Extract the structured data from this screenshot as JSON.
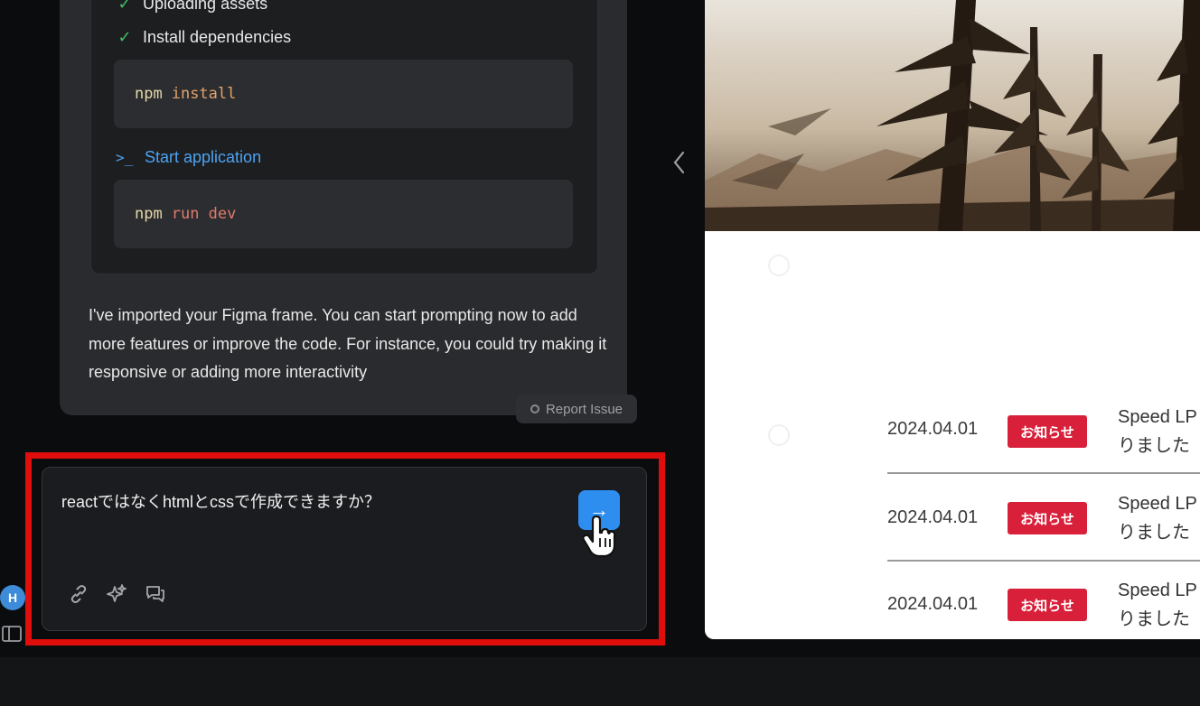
{
  "chat": {
    "steps": [
      {
        "status": "done",
        "label": "Uploading assets"
      },
      {
        "status": "done",
        "label": "Install dependencies"
      }
    ],
    "install_cmd": {
      "cmd": "npm",
      "arg": "install"
    },
    "start_label": "Start application",
    "run_cmd": {
      "cmd": "npm",
      "arg": "run dev"
    },
    "message": "I've imported your Figma frame. You can start prompting now to add more features or improve the code. For instance, you could try making it responsive or adding more interactivity",
    "report_label": "Report Issue"
  },
  "composer": {
    "text": "reactではなくhtmlとcssで作成できますか？",
    "send_icon": "arrow-right-icon",
    "tools": [
      "link-icon",
      "sparkle-icon",
      "chat-icon"
    ]
  },
  "user": {
    "initial": "H"
  },
  "preview": {
    "news": [
      {
        "date": "2024.04.01",
        "badge": "お知らせ",
        "title": "Speed LP\nりました"
      },
      {
        "date": "2024.04.01",
        "badge": "お知らせ",
        "title": "Speed LP\nりました"
      },
      {
        "date": "2024.04.01",
        "badge": "お知らせ",
        "title": "Speed LP\nりました"
      }
    ]
  },
  "colors": {
    "highlight": "#e00d0d",
    "send_button": "#2d8ef0",
    "badge": "#d8203a",
    "check": "#3fbf6a",
    "link": "#4da3f2"
  }
}
